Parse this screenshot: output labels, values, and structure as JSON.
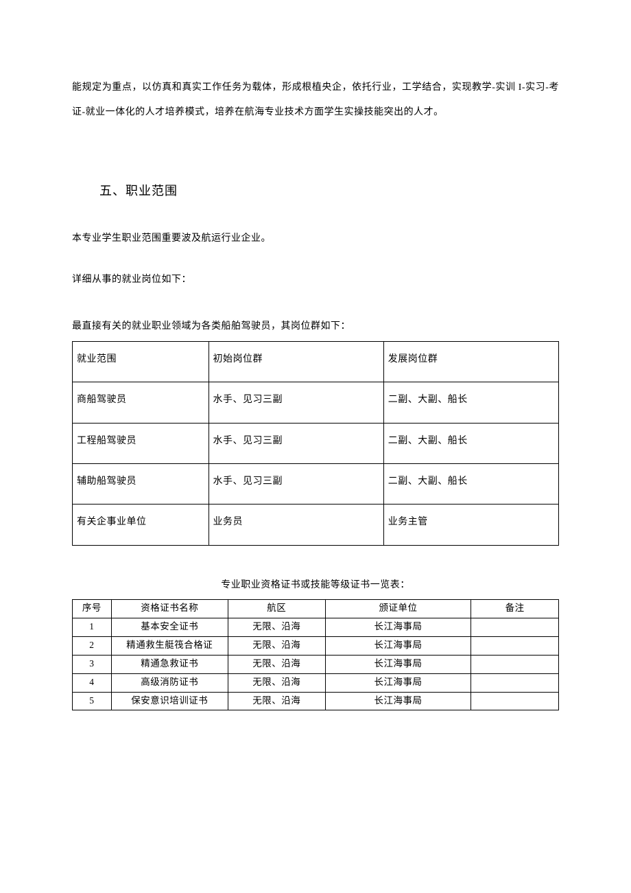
{
  "intro_para": "能规定为重点，以仿真和真实工作任务为载体，形成根植央企，依托行业，工学结合，实现教学-实训 I-实习-考证-就业一体化的人才培养模式，培养在航海专业技术方面学生实操技能突出的人才。",
  "section_title": "五、职业范围",
  "sub_para_1": "本专业学生职业范围重要波及航运行业企业。",
  "sub_para_2": "详细从事的就业岗位如下：",
  "table1_caption": "最直接有关的就业职业领域为各类船舶驾驶员，其岗位群如下：",
  "table1": {
    "header": [
      "就业范围",
      "初始岗位群",
      "发展岗位群"
    ],
    "rows": [
      [
        "商船驾驶员",
        "水手、见习三副",
        "二副、大副、船长"
      ],
      [
        "工程船驾驶员",
        "水手、见习三副",
        "二副、大副、船长"
      ],
      [
        "辅助船驾驶员",
        "水手、见习三副",
        "二副、大副、船长"
      ],
      [
        "有关企事业单位",
        "业务员",
        "业务主管"
      ]
    ]
  },
  "table2_caption": "专业职业资格证书或技能等级证书一览表：",
  "table2": {
    "header": [
      "序号",
      "资格证书名称",
      "航区",
      "颁证单位",
      "备注"
    ],
    "rows": [
      [
        "1",
        "基本安全证书",
        "无限、沿海",
        "长江海事局",
        ""
      ],
      [
        "2",
        "精通救生艇筏合格证",
        "无限、沿海",
        "长江海事局",
        ""
      ],
      [
        "3",
        "精通急救证书",
        "无限、沿海",
        "长江海事局",
        ""
      ],
      [
        "4",
        "高级消防证书",
        "无限、沿海",
        "长江海事局",
        ""
      ],
      [
        "5",
        "保安意识培训证书",
        "无限、沿海",
        "长江海事局",
        ""
      ]
    ]
  }
}
